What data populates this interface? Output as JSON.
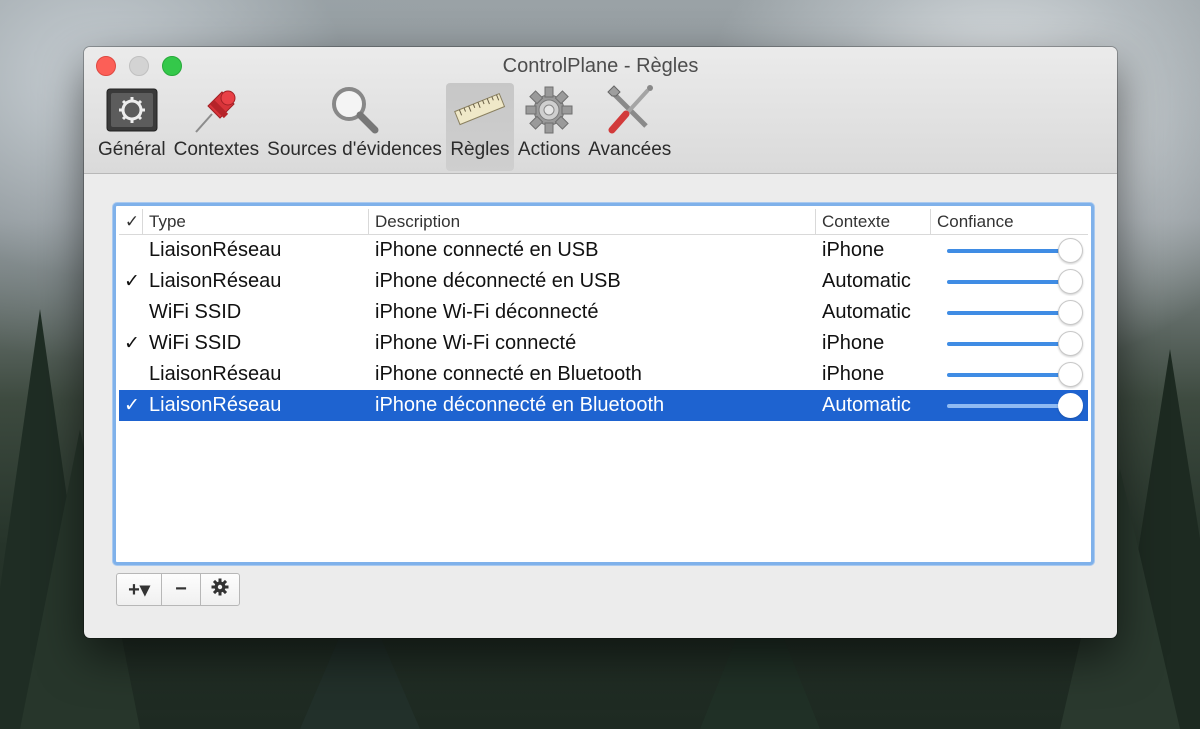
{
  "window": {
    "title": "ControlPlane - Règles",
    "traffic_lights": [
      "close",
      "minimize",
      "zoom"
    ]
  },
  "toolbar": {
    "active": "Règles",
    "items": [
      {
        "label": "Général",
        "icon": "general-switch-icon"
      },
      {
        "label": "Contextes",
        "icon": "pushpin-icon"
      },
      {
        "label": "Sources d'évidences",
        "icon": "magnifier-icon"
      },
      {
        "label": "Règles",
        "icon": "ruler-icon"
      },
      {
        "label": "Actions",
        "icon": "gear-icon"
      },
      {
        "label": "Avancées",
        "icon": "tools-icon"
      }
    ]
  },
  "table": {
    "headers": {
      "check": "✓",
      "type": "Type",
      "description": "Description",
      "context": "Contexte",
      "confidence": "Confiance"
    },
    "rows": [
      {
        "checked": false,
        "check": "",
        "type": "LiaisonRéseau",
        "description": "iPhone connecté en USB",
        "context": "iPhone",
        "confidence": 1.0
      },
      {
        "checked": true,
        "check": "✓",
        "type": "LiaisonRéseau",
        "description": "iPhone déconnecté en USB",
        "context": "Automatic",
        "confidence": 1.0
      },
      {
        "checked": false,
        "check": "",
        "type": "WiFi SSID",
        "description": "iPhone Wi-Fi déconnecté",
        "context": "Automatic",
        "confidence": 1.0
      },
      {
        "checked": true,
        "check": "✓",
        "type": "WiFi SSID",
        "description": "iPhone Wi-Fi connecté",
        "context": "iPhone",
        "confidence": 1.0
      },
      {
        "checked": false,
        "check": "",
        "type": "LiaisonRéseau",
        "description": "iPhone connecté en Bluetooth",
        "context": "iPhone",
        "confidence": 1.0
      },
      {
        "checked": true,
        "check": "✓",
        "type": "LiaisonRéseau",
        "description": "iPhone déconnecté en Bluetooth",
        "context": "Automatic",
        "confidence": 1.0,
        "selected": true
      }
    ]
  },
  "buttons": {
    "add": "+▾",
    "remove": "−",
    "settings_icon": "gear-icon"
  },
  "colors": {
    "selection": "#1e63d0",
    "slider_track": "#3f8ce4",
    "focus_ring": "#7fb1ea"
  }
}
